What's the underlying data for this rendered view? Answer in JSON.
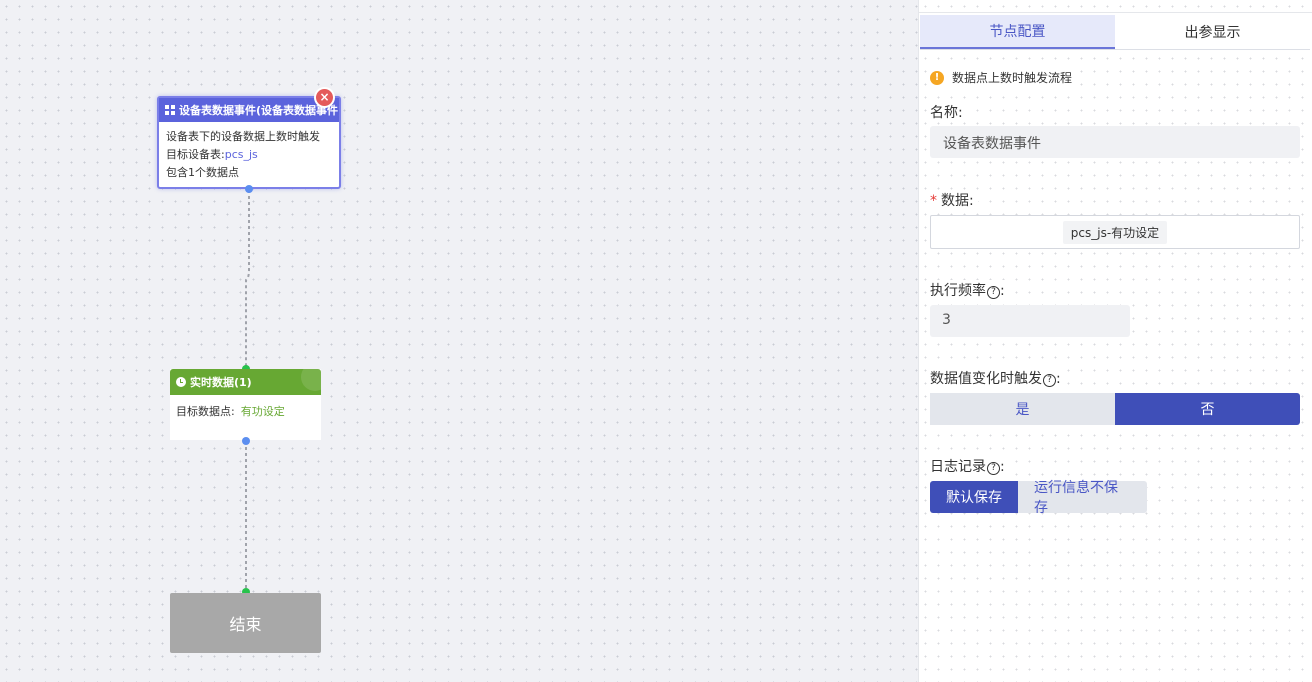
{
  "canvas": {
    "event_node": {
      "title": "设备表数据事件(设备表数据事件)",
      "line1": "设备表下的设备数据上数时触发",
      "line2_label": "目标设备表:",
      "line2_value": "pcs_js",
      "line3": "包含1个数据点",
      "close_icon": "×"
    },
    "realtime_node": {
      "title": "实时数据(1)",
      "label": "目标数据点:",
      "value": "有功设定"
    },
    "end_node": {
      "label": "结束"
    }
  },
  "panel": {
    "tabs": [
      {
        "label": "节点配置",
        "active": true
      },
      {
        "label": "出参显示",
        "active": false
      }
    ],
    "warning": "数据点上数时触发流程",
    "name_label": "名称:",
    "name_value": "设备表数据事件",
    "data_label": "数据:",
    "data_tag": "pcs_js-有功设定",
    "freq_label": "执行频率",
    "freq_value": "3",
    "trigger_label": "数据值变化时触发",
    "trigger_options": [
      {
        "label": "是",
        "selected": false
      },
      {
        "label": "否",
        "selected": true
      }
    ],
    "log_label": "日志记录",
    "log_options": [
      {
        "label": "默认保存",
        "selected": true
      },
      {
        "label": "运行信息不保存",
        "selected": false
      }
    ],
    "colon": ":",
    "help_icon": "?",
    "warning_icon": "!"
  },
  "colors": {
    "accent": "#3f4fb8",
    "event_header": "#5b63dc",
    "realtime_header": "#67a833",
    "end_node": "#a8a8a8"
  }
}
